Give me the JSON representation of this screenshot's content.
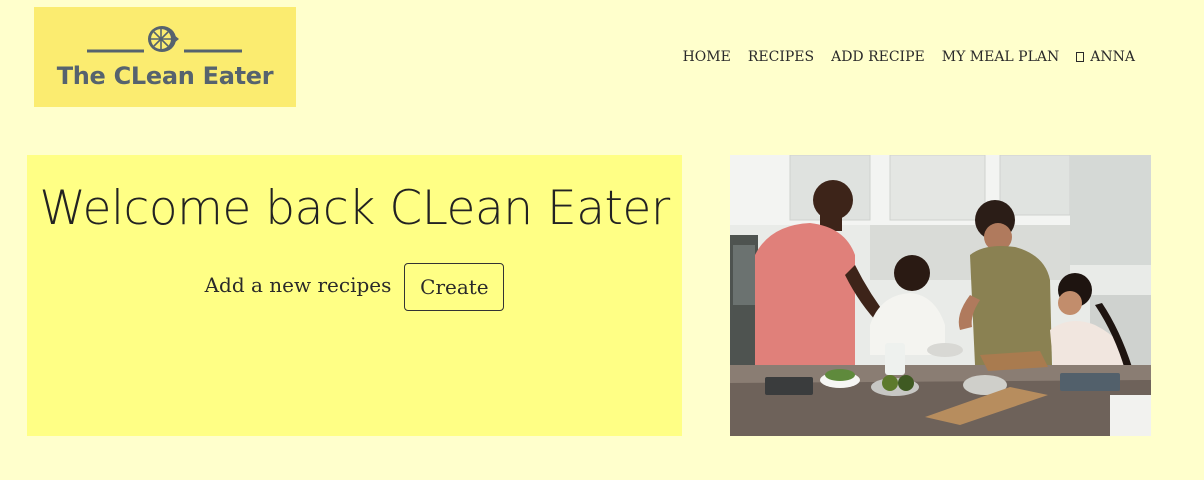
{
  "logo": {
    "text": "The CLean Eater",
    "icon": "lemon-icon"
  },
  "nav": {
    "items": [
      {
        "label": "HOME"
      },
      {
        "label": "RECIPES"
      },
      {
        "label": "ADD RECIPE"
      },
      {
        "label": "MY MEAL PLAN"
      }
    ],
    "user": {
      "label": "ANNA",
      "icon": "user-icon"
    }
  },
  "hero": {
    "title": "Welcome back CLean Eater",
    "prompt": "Add a new recipes",
    "button_label": "Create"
  },
  "colors": {
    "page_bg": "#ffffcc",
    "logo_bg": "#fbec70",
    "hero_bg": "#ffff85",
    "logo_text": "#56636e"
  }
}
